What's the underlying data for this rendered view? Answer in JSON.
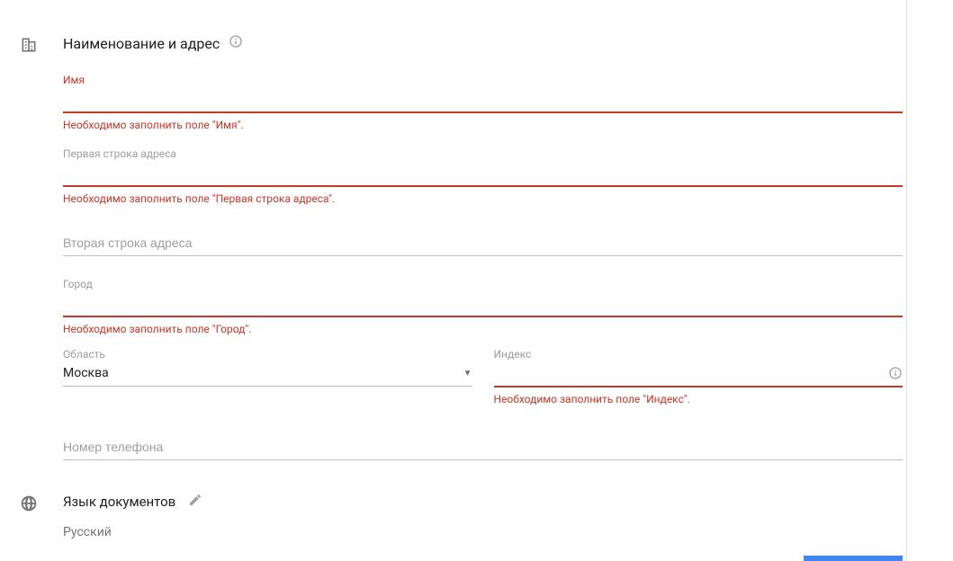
{
  "address_section": {
    "title": "Наименование и адрес",
    "name_label": "Имя",
    "name_error": "Необходимо заполнить поле \"Имя\".",
    "addr1_label": "Первая строка адреса",
    "addr1_error": "Необходимо заполнить поле \"Первая строка адреса\".",
    "addr2_placeholder": "Вторая строка адреса",
    "city_label": "Город",
    "city_error": "Необходимо заполнить поле \"Город\".",
    "region_label": "Область",
    "region_value": "Москва",
    "index_label": "Индекс",
    "index_error": "Необходимо заполнить поле \"Индекс\".",
    "phone_placeholder": "Номер телефона"
  },
  "lang_section": {
    "title": "Язык документов",
    "value": "Русский"
  }
}
